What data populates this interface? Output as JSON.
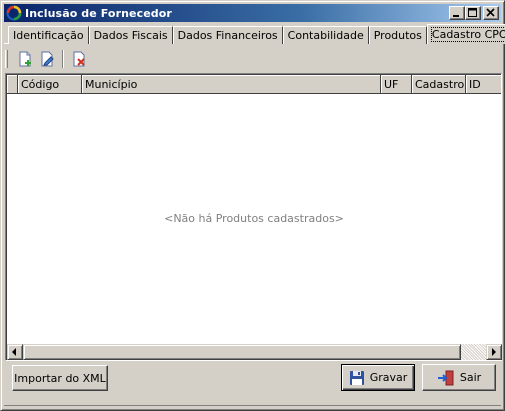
{
  "window": {
    "title": "Inclusão de Fornecedor",
    "controls": {
      "minimize": "minimize",
      "maximize": "maximize",
      "close": "close"
    }
  },
  "tabs": [
    {
      "label": "Identificação",
      "active": false
    },
    {
      "label": "Dados Fiscais",
      "active": false
    },
    {
      "label": "Dados Financeiros",
      "active": false
    },
    {
      "label": "Contabilidade",
      "active": false
    },
    {
      "label": "Produtos",
      "active": false
    },
    {
      "label": "Cadastro CPOM",
      "active": true
    }
  ],
  "toolbar": {
    "buttons": [
      {
        "icon": "new-record-icon"
      },
      {
        "icon": "edit-record-icon"
      },
      {
        "icon": "delete-record-icon"
      }
    ]
  },
  "grid": {
    "columns": [
      "",
      "Código",
      "Município",
      "UF",
      "Cadastro",
      "ID"
    ],
    "rows": [],
    "empty_message": "<Não há Produtos cadastrados>"
  },
  "buttons": {
    "import_label": "Importar do XML",
    "save_label": "Gravar",
    "exit_label": "Sair"
  },
  "colors": {
    "titlebar_start": "#0a246a",
    "titlebar_end": "#a6caf0",
    "face": "#d4d0c8"
  }
}
